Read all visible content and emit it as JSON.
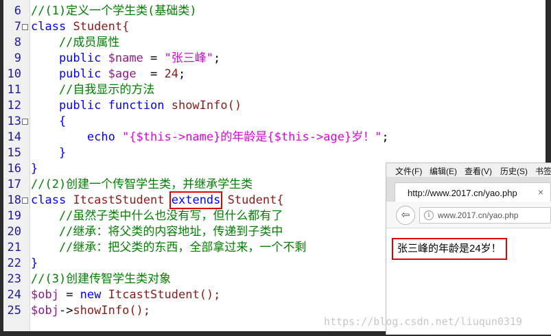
{
  "editor": {
    "lines": [
      {
        "num": "6",
        "fold": false,
        "tokens": [
          {
            "t": "//(1)定义一个学生类(基础类)",
            "c": "cmt"
          }
        ]
      },
      {
        "num": "7",
        "fold": true,
        "tokens": [
          {
            "t": "class",
            "c": "kw"
          },
          {
            "t": " ",
            "c": "plain"
          },
          {
            "t": "Student{",
            "c": "cls"
          }
        ]
      },
      {
        "num": "8",
        "fold": false,
        "tokens": [
          {
            "t": "    //成员属性",
            "c": "cmt"
          }
        ]
      },
      {
        "num": "9",
        "fold": false,
        "tokens": [
          {
            "t": "    public",
            "c": "kw"
          },
          {
            "t": " ",
            "c": "plain"
          },
          {
            "t": "$name",
            "c": "var"
          },
          {
            "t": " = ",
            "c": "plain"
          },
          {
            "t": "\"张三峰\"",
            "c": "str"
          },
          {
            "t": ";",
            "c": "plain"
          }
        ]
      },
      {
        "num": "10",
        "fold": false,
        "tokens": [
          {
            "t": "    public",
            "c": "kw"
          },
          {
            "t": " ",
            "c": "plain"
          },
          {
            "t": "$age",
            "c": "var"
          },
          {
            "t": "  = ",
            "c": "plain"
          },
          {
            "t": "24",
            "c": "num"
          },
          {
            "t": ";",
            "c": "plain"
          }
        ]
      },
      {
        "num": "11",
        "fold": false,
        "tokens": [
          {
            "t": "    //自我显示的方法",
            "c": "cmt"
          }
        ]
      },
      {
        "num": "12",
        "fold": false,
        "tokens": [
          {
            "t": "    public function",
            "c": "kw"
          },
          {
            "t": " ",
            "c": "plain"
          },
          {
            "t": "showInfo()",
            "c": "cls"
          }
        ]
      },
      {
        "num": "13",
        "fold": true,
        "tokens": [
          {
            "t": "    {",
            "c": "kw"
          }
        ]
      },
      {
        "num": "14",
        "fold": false,
        "tokens": [
          {
            "t": "        echo",
            "c": "kw"
          },
          {
            "t": " ",
            "c": "plain"
          },
          {
            "t": "\"{$this->name}的年龄是{$this->age}岁！\"",
            "c": "str"
          },
          {
            "t": ";",
            "c": "plain"
          }
        ]
      },
      {
        "num": "15",
        "fold": false,
        "tokens": [
          {
            "t": "    }",
            "c": "kw"
          }
        ]
      },
      {
        "num": "16",
        "fold": false,
        "tokens": [
          {
            "t": "}",
            "c": "kw"
          }
        ]
      },
      {
        "num": "17",
        "fold": false,
        "tokens": [
          {
            "t": "//(2)创建一个传智学生类，并继承学生类",
            "c": "cmt"
          }
        ]
      },
      {
        "num": "18",
        "fold": true,
        "tokens": [
          {
            "t": "class",
            "c": "kw"
          },
          {
            "t": " ",
            "c": "plain"
          },
          {
            "t": "ItcastStudent",
            "c": "cls"
          },
          {
            "t": " ",
            "c": "plain"
          },
          {
            "t": "extends",
            "c": "kw",
            "box": true
          },
          {
            "t": " ",
            "c": "plain"
          },
          {
            "t": "Student{",
            "c": "cls"
          }
        ]
      },
      {
        "num": "19",
        "fold": false,
        "tokens": [
          {
            "t": "    //虽然子类中什么也没有写，但什么都有了",
            "c": "cmt"
          }
        ]
      },
      {
        "num": "20",
        "fold": false,
        "tokens": [
          {
            "t": "    //继承：将父类的内容地址，传递到子类中",
            "c": "cmt"
          }
        ]
      },
      {
        "num": "21",
        "fold": false,
        "tokens": [
          {
            "t": "    //继承：把父类的东西，全部拿过来，一个不剩",
            "c": "cmt"
          }
        ]
      },
      {
        "num": "22",
        "fold": false,
        "tokens": [
          {
            "t": "}",
            "c": "kw"
          }
        ]
      },
      {
        "num": "23",
        "fold": false,
        "tokens": [
          {
            "t": "//(3)创建传智学生类对象",
            "c": "cmt"
          }
        ]
      },
      {
        "num": "24",
        "fold": false,
        "tokens": [
          {
            "t": "$obj",
            "c": "var"
          },
          {
            "t": " = ",
            "c": "plain"
          },
          {
            "t": "new",
            "c": "kw"
          },
          {
            "t": " ",
            "c": "plain"
          },
          {
            "t": "ItcastStudent();",
            "c": "cls"
          }
        ]
      },
      {
        "num": "25",
        "fold": false,
        "tokens": [
          {
            "t": "$obj",
            "c": "var"
          },
          {
            "t": "->",
            "c": "plain"
          },
          {
            "t": "showInfo();",
            "c": "cls"
          }
        ]
      }
    ]
  },
  "browser": {
    "menu": [
      "文件(F)",
      "编辑(E)",
      "查看(V)",
      "历史(S)",
      "书签"
    ],
    "tab_title": "http://www.2017.cn/yao.php",
    "tab_close": "×",
    "back_glyph": "⇦",
    "info_glyph": "i",
    "url": "www.2017.cn/yao.php",
    "output": "张三峰的年龄是24岁！"
  },
  "watermark": "https://blog.csdn.net/liuqun0319",
  "colors": {
    "keyword": "#0000ff",
    "comment": "#008000",
    "string": "#e000e0",
    "variable": "#8b1a8b",
    "identifier": "#8b1a1a",
    "highlight_box": "#e00000"
  }
}
